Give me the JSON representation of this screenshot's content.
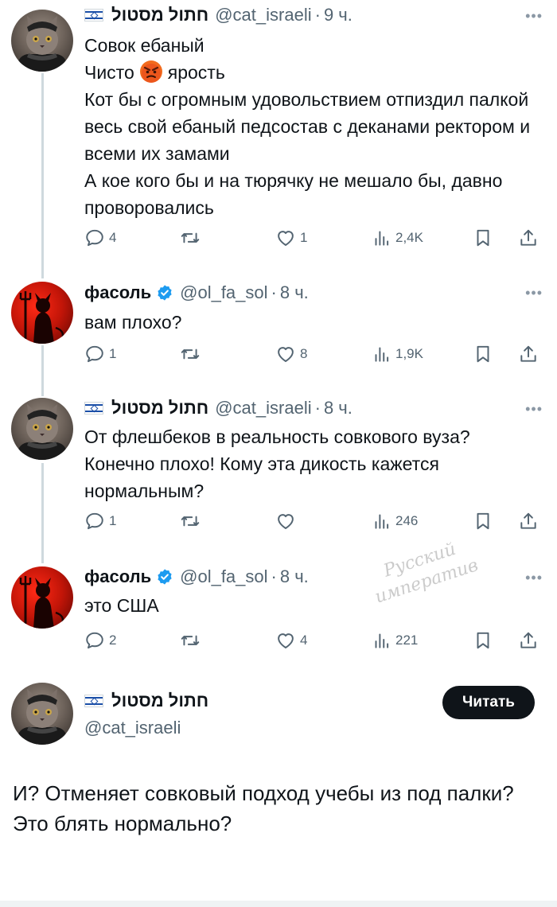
{
  "tweets": [
    {
      "name": "חתול מסטול",
      "handle": "@cat_israeli",
      "time": "9 ч.",
      "lines": [
        "Совок ебаный",
        "Чисто",
        "ярость",
        "Кот бы с огромным удовольствием отпиздил палкой весь свой ебаный педсостав с деканами ректором и всеми их замами",
        "А кое кого бы и на тюрячку не мешало бы, давно проворовались"
      ],
      "replies": "4",
      "retweets": "",
      "likes": "1",
      "views": "2,4K"
    },
    {
      "name": "фасоль",
      "handle": "@ol_fa_sol",
      "time": "8 ч.",
      "lines": [
        "вам плохо?"
      ],
      "replies": "1",
      "retweets": "",
      "likes": "8",
      "views": "1,9K"
    },
    {
      "name": "חתול מסטול",
      "handle": "@cat_israeli",
      "time": "8 ч.",
      "lines": [
        "От флешбеков в реальность совкового вуза? Конечно плохо! Кому эта дикость кажется нормальным?"
      ],
      "replies": "1",
      "retweets": "",
      "likes": "",
      "views": "246"
    },
    {
      "name": "фасоль",
      "handle": "@ol_fa_sol",
      "time": "8 ч.",
      "lines": [
        "это США"
      ],
      "replies": "2",
      "retweets": "",
      "likes": "4",
      "views": "221"
    }
  ],
  "main": {
    "name": "חתול מסטול",
    "handle": "@cat_israeli",
    "follow_label": "Читать",
    "lines": [
      "И? Отменяет совковый подход учебы из под палки?",
      "Это блять нормально?"
    ]
  },
  "watermark": [
    "Русский",
    "императив"
  ],
  "icons": {
    "more": "more-icon",
    "reply": "reply-icon",
    "retweet": "retweet-icon",
    "like": "heart-icon",
    "views": "views-icon",
    "bookmark": "bookmark-icon",
    "share": "share-icon"
  },
  "colors": {
    "verified": "#1d9bf0",
    "text": "#0f1419",
    "muted": "#536471",
    "button": "#0f1419"
  }
}
